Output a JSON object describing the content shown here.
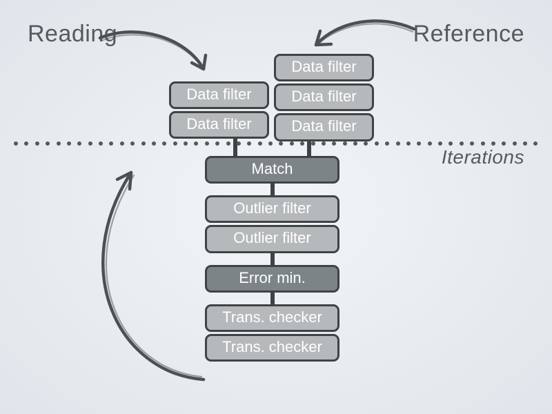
{
  "labels": {
    "reading": "Reading",
    "reference": "Reference",
    "iterations": "Iterations"
  },
  "reading_stack": [
    {
      "text": "Data filter",
      "style": "light"
    },
    {
      "text": "Data filter",
      "style": "light"
    }
  ],
  "reference_stack": [
    {
      "text": "Data filter",
      "style": "light"
    },
    {
      "text": "Data filter",
      "style": "light"
    },
    {
      "text": "Data filter",
      "style": "light"
    }
  ],
  "main_stack": [
    {
      "text": "Match",
      "style": "dark",
      "gap": true
    },
    {
      "text": "Outlier filter",
      "style": "light",
      "gap": false
    },
    {
      "text": "Outlier filter",
      "style": "light",
      "gap": true
    },
    {
      "text": "Error min.",
      "style": "dark",
      "gap": true
    },
    {
      "text": "Trans. checker",
      "style": "light",
      "gap": false
    },
    {
      "text": "Trans. checker",
      "style": "light",
      "gap": false
    }
  ]
}
